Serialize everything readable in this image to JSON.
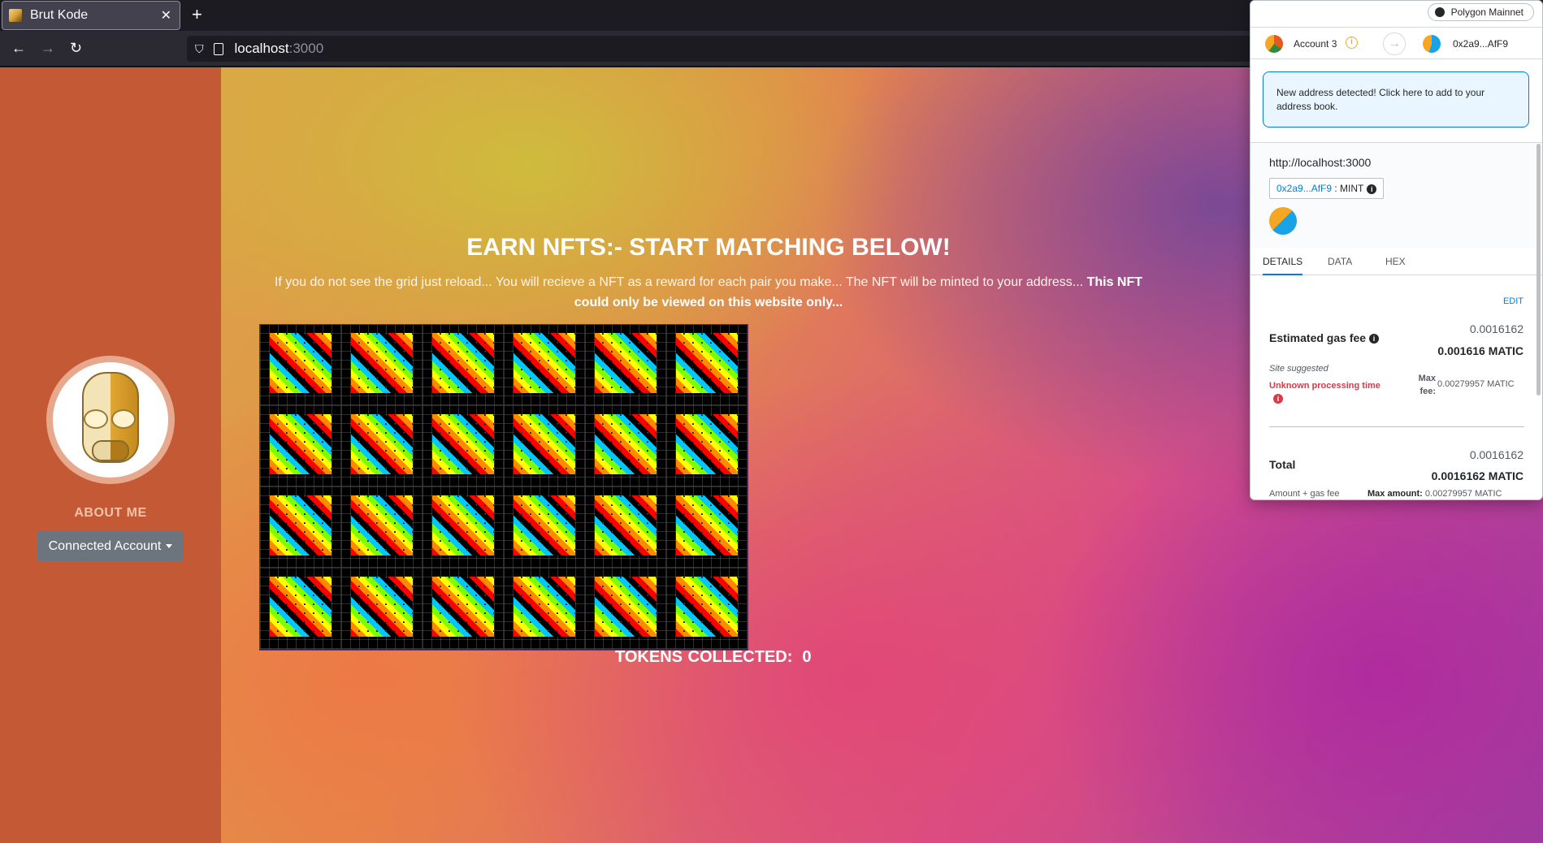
{
  "browser": {
    "tab_title": "Brut Kode",
    "tab_close": "✕",
    "new_tab": "+",
    "url_host": "localhost",
    "url_port": ":3000",
    "back": "←",
    "forward": "→",
    "reload": "↻"
  },
  "sidebar": {
    "about_label": "ABOUT ME",
    "connected_button": "Connected Account"
  },
  "main": {
    "headline": "EARN NFTS:- START MATCHING BELOW!",
    "subtext_plain": "If you do not see the grid just reload... You will recieve a NFT as a reward for each pair you make... The NFT will be minted to your address... ",
    "subtext_bold": "This NFT could only be viewed on this website only...",
    "tokens_label": "TOKENS COLLECTED:",
    "tokens_count": "0",
    "grid": {
      "rows": 4,
      "columns": 6
    }
  },
  "metamask": {
    "network": "Polygon Mainnet",
    "from_account": "Account 3",
    "to_account": "0x2a9...AfF9",
    "banner": "New address detected! Click here to add to your address book.",
    "origin": "http://localhost:3000",
    "method_address": "0x2a9...AfF9",
    "method_name": " : MINT",
    "tabs": [
      "DETAILS",
      "DATA",
      "HEX"
    ],
    "edit": "EDIT",
    "gas_fee_label": "Estimated gas fee",
    "gas_fee_top": "0.0016162",
    "gas_fee_main": "0.001616 MATIC",
    "site_suggested": "Site suggested",
    "unknown_time": "Unknown processing time",
    "max_fee_label": "Max fee:",
    "max_fee_value": "0.00279957 MATIC",
    "total_label": "Total",
    "total_top": "0.0016162",
    "total_main": "0.0016162 MATIC",
    "amount_gas": "Amount + gas fee",
    "max_amount_label": "Max amount:",
    "max_amount_value": "0.00279957 MATIC"
  },
  "colors": {
    "sidebar": "#c35a35",
    "button": "#6c757d",
    "metamask_link": "#037dd6",
    "warning_red": "#d73a49"
  }
}
